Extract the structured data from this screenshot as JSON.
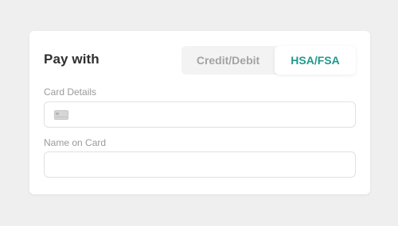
{
  "form": {
    "title": "Pay with",
    "tabs": [
      {
        "label": "Credit/Debit",
        "selected": false
      },
      {
        "label": "HSA/FSA",
        "selected": true
      }
    ],
    "card_details_label": "Card Details",
    "card_details_value": "",
    "card_icon": "credit-card-icon",
    "name_on_card_label": "Name on Card",
    "name_on_card_value": ""
  },
  "colors": {
    "accent": "#1f9a8c",
    "page_background": "#efefef",
    "panel_background": "#ffffff"
  }
}
